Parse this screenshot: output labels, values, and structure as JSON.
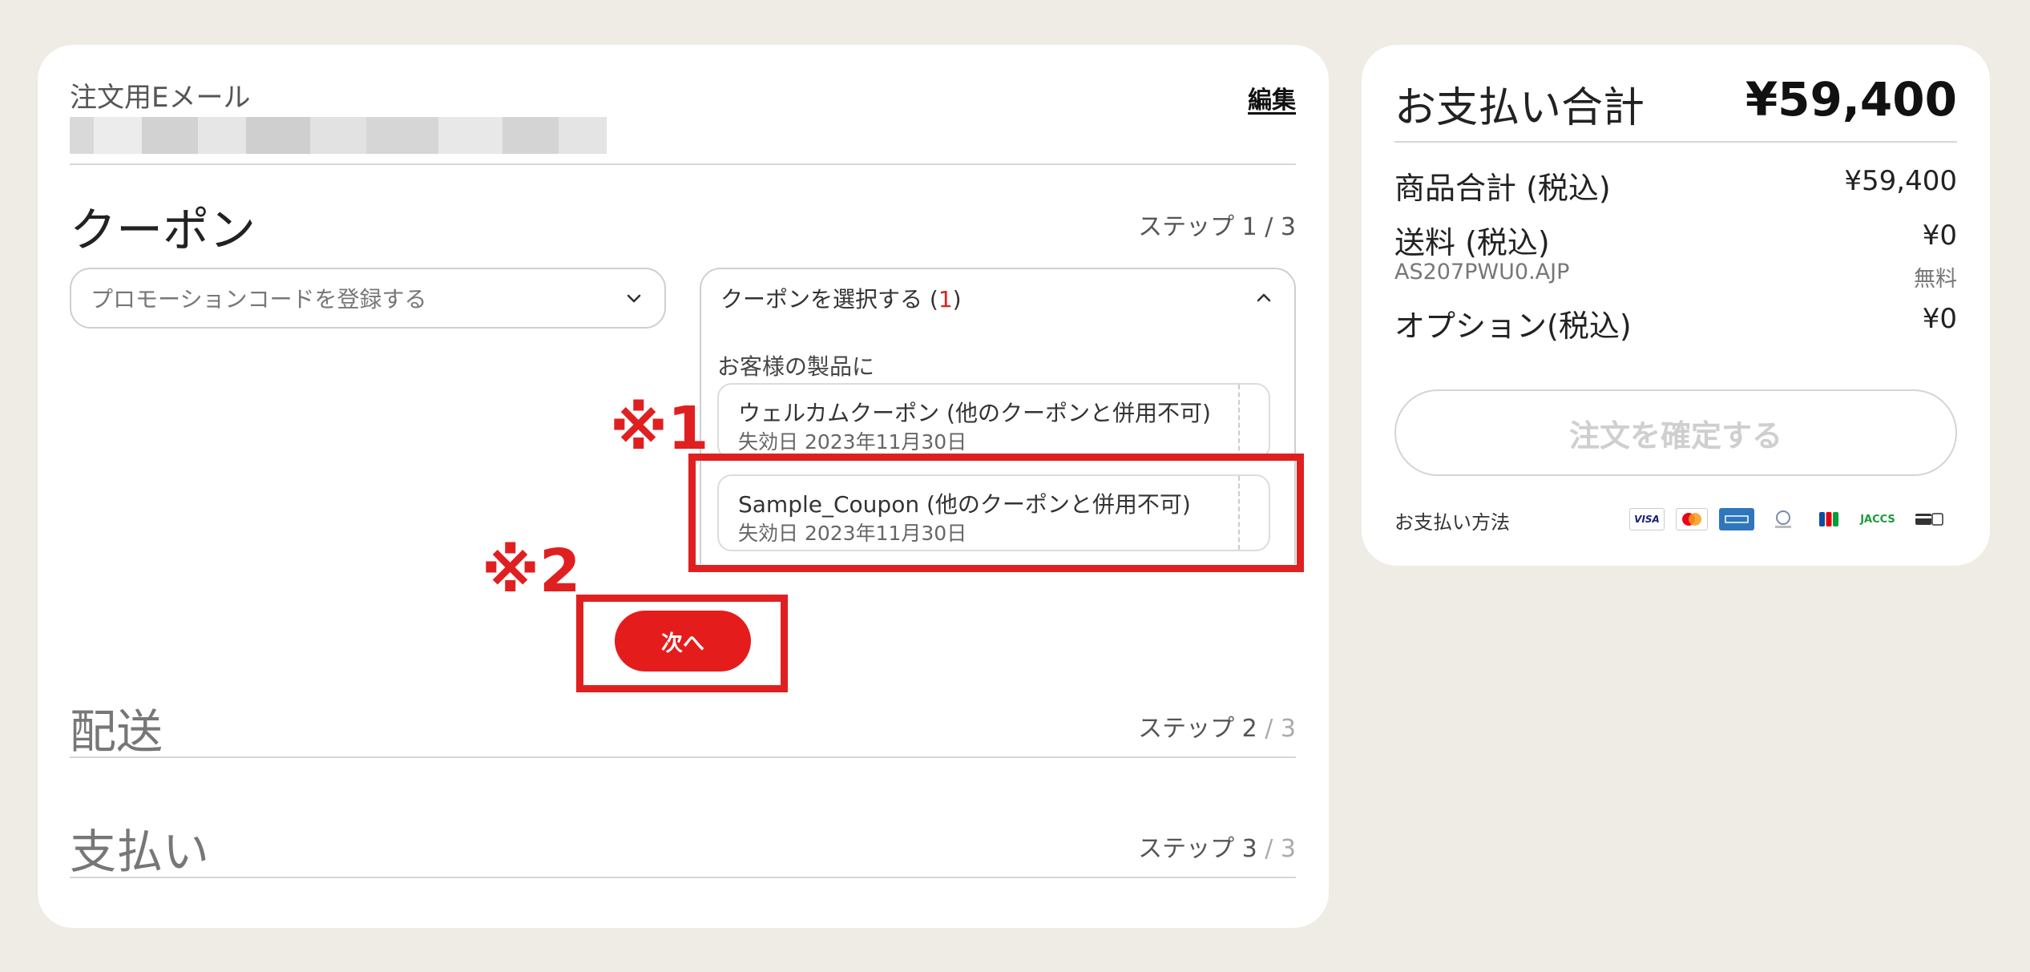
{
  "email": {
    "label": "注文用Eメール",
    "edit": "編集"
  },
  "coupon_section": {
    "title": "クーポン",
    "step": "ステップ 1",
    "step_total": " / 3",
    "promo_placeholder": "プロモーションコードを登録する",
    "select_label": "クーポンを選択する (",
    "select_count": "1",
    "select_close": ")",
    "panel_label": "お客様の製品に",
    "coupons": [
      {
        "name": "ウェルカムクーポン (他のクーポンと併用不可)",
        "expiry": "失効日 2023年11月30日"
      },
      {
        "name": "Sample_Coupon (他のクーポンと併用不可)",
        "expiry": "失効日 2023年11月30日"
      }
    ],
    "next_button": "次へ"
  },
  "annotations": {
    "mark1": "※1",
    "mark2": "※2",
    "color": "#e02020"
  },
  "shipping_section": {
    "title": "配送",
    "step": "ステップ 2",
    "step_total": " / 3"
  },
  "payment_section": {
    "title": "支払い",
    "step": "ステップ 3",
    "step_total": " / 3"
  },
  "summary": {
    "total_label": "お支払い合計",
    "total_value": "¥59,400",
    "rows": [
      {
        "label": "商品合計 (税込)",
        "value": "¥59,400"
      },
      {
        "label": "送料 (税込)",
        "value": "¥0",
        "sub_label": "AS207PWU0.AJP",
        "sub_value": "無料"
      },
      {
        "label": "オプション(税込)",
        "value": "¥0"
      }
    ],
    "confirm_button": "注文を確定する",
    "payment_methods_label": "お支払い方法",
    "payment_icons": [
      {
        "name": "visa-icon",
        "text": "VISA"
      },
      {
        "name": "mastercard-icon",
        "text": ""
      },
      {
        "name": "amex-icon",
        "text": ""
      },
      {
        "name": "diners-icon",
        "text": ""
      },
      {
        "name": "jcb-icon",
        "text": ""
      },
      {
        "name": "jaccs-icon",
        "text": "JACCS"
      },
      {
        "name": "card-icon",
        "text": ""
      }
    ]
  },
  "colors": {
    "accent": "#e51c1c",
    "background": "#efebe5",
    "panel": "#ffffff"
  }
}
